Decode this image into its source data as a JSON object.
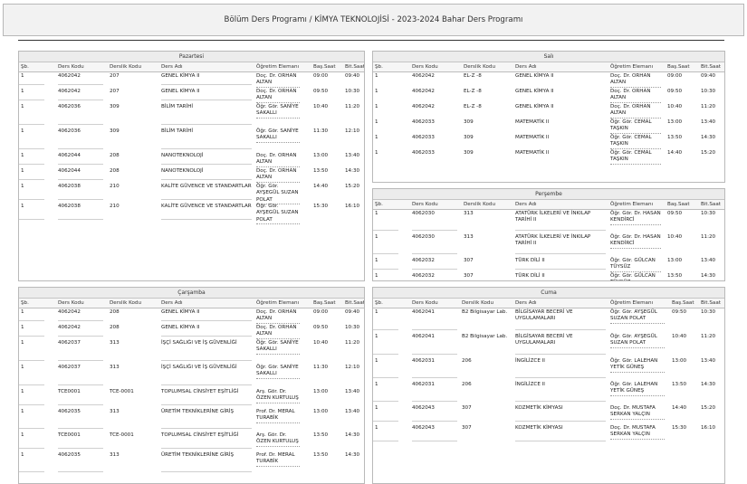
{
  "page": {
    "title": "Bölüm Ders Programı / KİMYA TEKNOLOJİSİ - 2023-2024 Bahar Ders Programı"
  },
  "columns": {
    "sb": "Şb.",
    "code": "Ders Kodu",
    "room": "Derslik Kodu",
    "name": "Ders Adı",
    "teacher": "Öğretim Elemanı",
    "start": "Baş.Saat",
    "end": "Bit.Saat"
  },
  "days": [
    {
      "id": "pazartesi",
      "name": "Pazartesi",
      "rows": [
        {
          "sb": "1",
          "code": "4062042",
          "room": "207",
          "name": "GENEL KİMYA II",
          "teacher": "Doç. Dr. ORHAN ALTAN",
          "start": "09:00",
          "end": "09:40"
        },
        {
          "sb": "1",
          "code": "4062042",
          "room": "207",
          "name": "GENEL KİMYA II",
          "teacher": "Doç. Dr. ORHAN ALTAN",
          "start": "09:50",
          "end": "10:30"
        },
        {
          "sb": "1",
          "code": "4062036",
          "room": "309",
          "name": "BİLİM TARİHİ",
          "teacher": "Öğr. Gör. SANİYE SAKALLI",
          "start": "10:40",
          "end": "11:20"
        },
        {
          "sb": "1",
          "code": "4062036",
          "room": "309",
          "name": "BİLİM TARİHİ",
          "teacher": "Öğr. Gör. SANİYE SAKALLI",
          "start": "11:30",
          "end": "12:10"
        },
        {
          "sb": "1",
          "code": "4062044",
          "room": "208",
          "name": "NANOTEKNOLOJİ",
          "teacher": "Doç. Dr. ORHAN ALTAN",
          "start": "13:00",
          "end": "13:40"
        },
        {
          "sb": "1",
          "code": "4062044",
          "room": "208",
          "name": "NANOTEKNOLOJİ",
          "teacher": "Doç. Dr. ORHAN ALTAN",
          "start": "13:50",
          "end": "14:30"
        },
        {
          "sb": "1",
          "code": "4062038",
          "room": "210",
          "name": "KALİTE GÜVENCE VE STANDARTLAR",
          "teacher": "Öğr. Gör. AYŞEGÜL SUZAN POLAT",
          "start": "14:40",
          "end": "15:20"
        },
        {
          "sb": "1",
          "code": "4062038",
          "room": "210",
          "name": "KALİTE GÜVENCE VE STANDARTLAR",
          "teacher": "Öğr. Gör. AYŞEGÜL SUZAN POLAT",
          "start": "15:30",
          "end": "16:10"
        }
      ]
    },
    {
      "id": "sali",
      "name": "Salı",
      "rows": [
        {
          "sb": "1",
          "code": "4062042",
          "room": "EL-Z -8",
          "name": "GENEL KİMYA II",
          "teacher": "Doç. Dr. ORHAN ALTAN",
          "start": "09:00",
          "end": "09:40"
        },
        {
          "sb": "1",
          "code": "4062042",
          "room": "EL-Z -8",
          "name": "GENEL KİMYA II",
          "teacher": "Doç. Dr. ORHAN ALTAN",
          "start": "09:50",
          "end": "10:30"
        },
        {
          "sb": "1",
          "code": "4062042",
          "room": "EL-Z -8",
          "name": "GENEL KİMYA II",
          "teacher": "Doç. Dr. ORHAN ALTAN",
          "start": "10:40",
          "end": "11:20"
        },
        {
          "sb": "1",
          "code": "4062033",
          "room": "309",
          "name": "MATEMATİK II",
          "teacher": "Öğr. Gör. CEMAL TAŞKIN",
          "start": "13:00",
          "end": "13:40"
        },
        {
          "sb": "1",
          "code": "4062033",
          "room": "309",
          "name": "MATEMATİK II",
          "teacher": "Öğr. Gör. CEMAL TAŞKIN",
          "start": "13:50",
          "end": "14:30"
        },
        {
          "sb": "1",
          "code": "4062033",
          "room": "309",
          "name": "MATEMATİK II",
          "teacher": "Öğr. Gör. CEMAL TAŞKIN",
          "start": "14:40",
          "end": "15:20"
        }
      ]
    },
    {
      "id": "persembe",
      "name": "Perşembe",
      "rows": [
        {
          "sb": "1",
          "code": "4062030",
          "room": "313",
          "name": "ATATÜRK İLKELERİ VE İNKILAP TARİHİ II",
          "teacher": "Öğr. Gör. Dr. HASAN KENDİRCİ",
          "start": "09:50",
          "end": "10:30"
        },
        {
          "sb": "1",
          "code": "4062030",
          "room": "313",
          "name": "ATATÜRK İLKELERİ VE İNKILAP TARİHİ II",
          "teacher": "Öğr. Gör. Dr. HASAN KENDİRCİ",
          "start": "10:40",
          "end": "11:20"
        },
        {
          "sb": "1",
          "code": "4062032",
          "room": "307",
          "name": "TÜRK DİLİ II",
          "teacher": "Öğr. Gör. GÜLCAN TÜYSÜZ",
          "start": "13:00",
          "end": "13:40"
        },
        {
          "sb": "1",
          "code": "4062032",
          "room": "307",
          "name": "TÜRK DİLİ II",
          "teacher": "Öğr. Gör. GÜLCAN TÜYSÜZ",
          "start": "13:50",
          "end": "14:30"
        }
      ]
    },
    {
      "id": "carsamba",
      "name": "Çarşamba",
      "rows": [
        {
          "sb": "1",
          "code": "4062042",
          "room": "208",
          "name": "GENEL KİMYA II",
          "teacher": "Doç. Dr. ORHAN ALTAN",
          "start": "09:00",
          "end": "09:40"
        },
        {
          "sb": "1",
          "code": "4062042",
          "room": "208",
          "name": "GENEL KİMYA II",
          "teacher": "Doç. Dr. ORHAN ALTAN",
          "start": "09:50",
          "end": "10:30"
        },
        {
          "sb": "1",
          "code": "4062037",
          "room": "313",
          "name": "İŞÇİ SAĞLIĞI VE İŞ GÜVENLİĞİ",
          "teacher": "Öğr. Gör. SANİYE SAKALLI",
          "start": "10:40",
          "end": "11:20"
        },
        {
          "sb": "1",
          "code": "4062037",
          "room": "313",
          "name": "İŞÇİ SAĞLIĞI VE İŞ GÜVENLİĞİ",
          "teacher": "Öğr. Gör. SANİYE SAKALLI",
          "start": "11:30",
          "end": "12:10"
        },
        {
          "sb": "1",
          "code": "TCE0001",
          "room": "TCE-0001",
          "name": "TOPLUMSAL CİNSİYET EŞİTLİĞİ",
          "teacher": "Arş. Gör. Dr. ÖZEN KURTULUŞ",
          "start": "13:00",
          "end": "13:40"
        },
        {
          "sb": "1",
          "code": "4062035",
          "room": "313",
          "name": "ÜRETİM TEKNİKLERİNE GİRİŞ",
          "teacher": "Prof. Dr. MERAL TURABİK",
          "start": "13:00",
          "end": "13:40"
        },
        {
          "sb": "1",
          "code": "TCE0001",
          "room": "TCE-0001",
          "name": "TOPLUMSAL CİNSİYET EŞİTLİĞİ",
          "teacher": "Arş. Gör. Dr. ÖZEN KURTULUŞ",
          "start": "13:50",
          "end": "14:30"
        },
        {
          "sb": "1",
          "code": "4062035",
          "room": "313",
          "name": "ÜRETİM TEKNİKLERİNE GİRİŞ",
          "teacher": "Prof. Dr. MERAL TURABİK",
          "start": "13:50",
          "end": "14:30"
        }
      ]
    },
    {
      "id": "cuma",
      "name": "Cuma",
      "rows": [
        {
          "sb": "1",
          "code": "4062041",
          "room": "B2 Bilgisayar Lab.",
          "name": "BİLGİSAYAR BECERİ VE UYGULAMALARI",
          "teacher": "Öğr. Gör. AYŞEGÜL SUZAN POLAT",
          "start": "09:50",
          "end": "10:30"
        },
        {
          "sb": "1",
          "code": "4062041",
          "room": "B2 Bilgisayar Lab.",
          "name": "BİLGİSAYAR BECERİ VE UYGULAMALARI",
          "teacher": "Öğr. Gör. AYŞEGÜL SUZAN POLAT",
          "start": "10:40",
          "end": "11:20"
        },
        {
          "sb": "1",
          "code": "4062031",
          "room": "206",
          "name": "İNGİLİZCE II",
          "teacher": "Öğr. Gör. LALEHAN YETİK GÜNEŞ",
          "start": "13:00",
          "end": "13:40"
        },
        {
          "sb": "1",
          "code": "4062031",
          "room": "206",
          "name": "İNGİLİZCE II",
          "teacher": "Öğr. Gör. LALEHAN YETİK GÜNEŞ",
          "start": "13:50",
          "end": "14:30"
        },
        {
          "sb": "1",
          "code": "4062043",
          "room": "307",
          "name": "KOZMETİK KİMYASI",
          "teacher": "Doç. Dr. MUSTAFA SERKAN YALÇIN",
          "start": "14:40",
          "end": "15:20"
        },
        {
          "sb": "1",
          "code": "4062043",
          "room": "307",
          "name": "KOZMETİK KİMYASI",
          "teacher": "Doç. Dr. MUSTAFA SERKAN YALÇIN",
          "start": "15:30",
          "end": "16:10"
        }
      ]
    }
  ]
}
